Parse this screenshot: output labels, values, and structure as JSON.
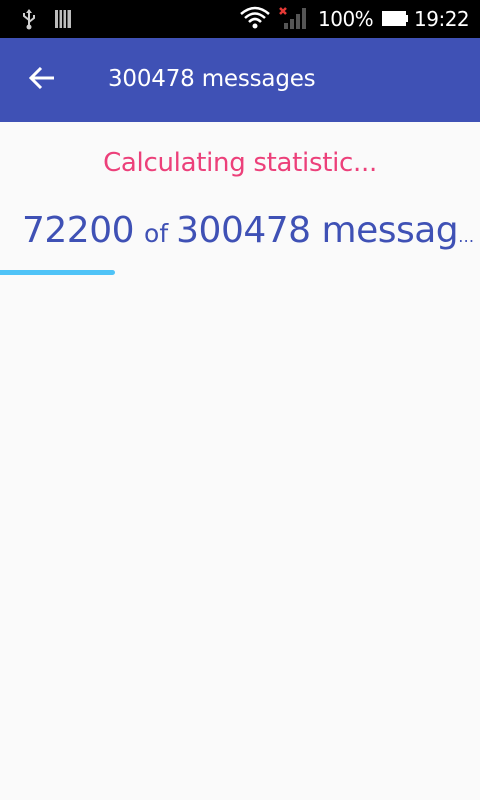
{
  "status_bar": {
    "battery_percent": "100%",
    "time": "19:22",
    "icons": [
      "usb-icon",
      "sd-card-icon",
      "wifi-icon",
      "signal-no-sim-icon",
      "battery-icon"
    ]
  },
  "app_bar": {
    "back_icon": "arrow-back-icon",
    "title": "300478 messages",
    "color": "#3f51b5"
  },
  "main": {
    "status_text": "Calculating statistic...",
    "status_color": "#ec407a",
    "progress": {
      "current": "72200",
      "of_label": "of",
      "total": "300478 messag…",
      "fraction": 0.24
    }
  }
}
